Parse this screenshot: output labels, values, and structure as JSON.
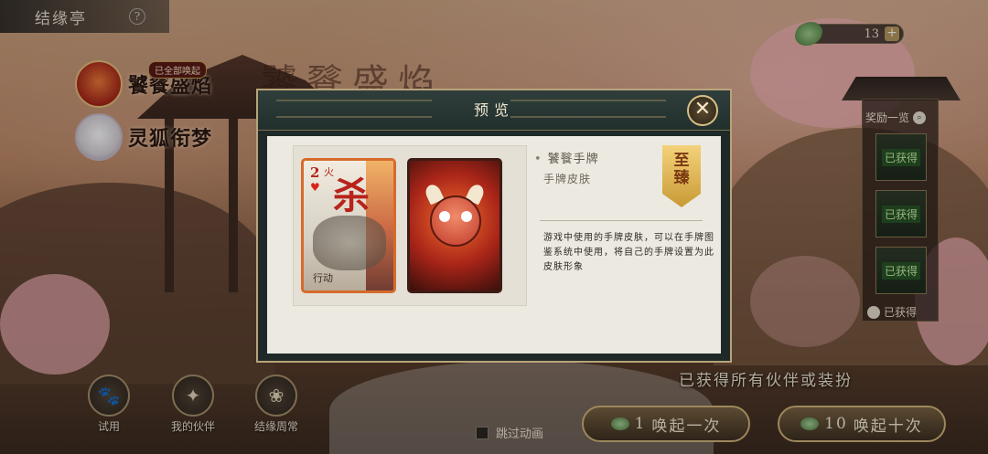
{
  "header": {
    "title": "结缘亭",
    "help_icon": "?"
  },
  "banners": [
    {
      "name": "饕餮盛焰",
      "tag": "已全部唤起"
    },
    {
      "name": "灵狐衔梦"
    }
  ],
  "background_title": "饕餮盛焰",
  "currency": {
    "count": "13",
    "plus": "+"
  },
  "reward_panel": {
    "title": "奖励一览",
    "slots": [
      "已获得",
      "已获得",
      "已获得"
    ],
    "footer": "已获得"
  },
  "modal": {
    "title": "预览",
    "close_label": "✕",
    "card": {
      "number": "2",
      "suit": "♥",
      "big_char": "杀",
      "small_char": "火",
      "action_text": "行动"
    },
    "item_name": "饕餮手牌",
    "item_type": "手牌皮肤",
    "badge": [
      "至",
      "臻"
    ],
    "description": "游戏中使用的手牌皮肤，可以在手牌图鉴系统中使用，将自己的手牌设置为此皮肤形象"
  },
  "bottom": {
    "obtained_all": "已获得所有伙伴或装扮",
    "buttons": [
      {
        "label": "试用",
        "icon": "🐾"
      },
      {
        "label": "我的伙伴",
        "icon": "✦"
      },
      {
        "label": "结缘周常",
        "icon": "❀"
      }
    ],
    "skip_label": "跳过动画",
    "summon_once": {
      "count": "1",
      "label": "唤起一次"
    },
    "summon_ten": {
      "count": "10",
      "label": "唤起十次"
    }
  },
  "colors": {
    "accent_gold": "#d2b47a",
    "modal_bg": "#ece9e1",
    "header_dark": "#22302d"
  }
}
